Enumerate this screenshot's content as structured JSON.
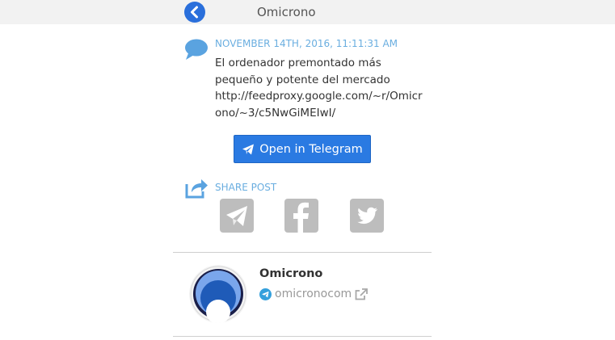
{
  "header": {
    "title": "Omicrono",
    "back_icon": "chevron-left-icon",
    "accent": "#2a6fdb"
  },
  "post": {
    "icon": "speech-bubble-icon",
    "date": "NOVEMBER 14TH, 2016, 11:11:31 AM",
    "text_lines": [
      "El ordenador premontado más",
      "pequeño y potente del mercado",
      "http://feedproxy.google.com/~r/Omicr",
      "ono/~3/c5NwGiMEIwI/"
    ]
  },
  "open_button": {
    "label": "Open in Telegram",
    "icon": "paper-plane-icon",
    "color": "#2a7ae2"
  },
  "share": {
    "icon": "share-arrow-icon",
    "label": "SHARE POST",
    "buttons": [
      {
        "name": "telegram",
        "icon": "telegram-icon"
      },
      {
        "name": "facebook",
        "icon": "facebook-icon"
      },
      {
        "name": "twitter",
        "icon": "twitter-icon"
      }
    ],
    "button_color": "#bdbdbd"
  },
  "channel": {
    "name": "Omicrono",
    "handle": "omicronocom",
    "handle_icon": "telegram-circle-icon",
    "external_icon": "external-link-icon"
  }
}
